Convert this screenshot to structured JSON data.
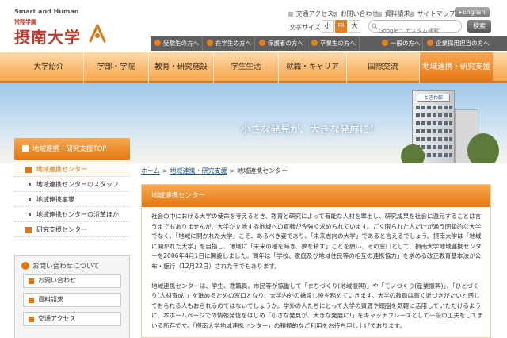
{
  "header": {
    "logo_tagline": "Smart and Human",
    "logo_subtitle": "常翔学園",
    "logo_name": "摂南大学",
    "utility_links": [
      "交通アクセス",
      "お問い合わせ",
      "資料請求",
      "サイトマップ"
    ],
    "english_label": "English",
    "font_size_label": "文字サイズ",
    "font_sizes": [
      "小",
      "中",
      "大"
    ],
    "search_placeholder": "Google™ カスタム検索",
    "search_button": "検索"
  },
  "audience_nav": [
    "受験生の方へ",
    "在学生の方へ",
    "保護者の方へ",
    "卒業生の方へ",
    "一般の方へ",
    "企業採用担当の方へ"
  ],
  "global_nav": {
    "items": [
      "大学紹介",
      "学部・学院",
      "教育・研究施設",
      "学生生活",
      "就職・キャリア",
      "国際交流",
      "地域連携・研究支援"
    ],
    "active_index": 6
  },
  "hero": {
    "tagline": "小さな発見が、大きな発展に！",
    "building_sign": "ときわ館"
  },
  "sidebar": {
    "heading": "地域連携・研究支援TOP",
    "items": [
      {
        "label": "地域連携センター",
        "kind": "current"
      },
      {
        "label": "地域連携センターのスタッフ",
        "kind": "sub"
      },
      {
        "label": "地域連携事業",
        "kind": "sub"
      },
      {
        "label": "地域連携センターの沿革ほか",
        "kind": "sub"
      },
      {
        "label": "研究支援センター",
        "kind": "main"
      }
    ],
    "contact": {
      "heading": "お問い合わせについて",
      "buttons": [
        "お問い合わせ",
        "資料請求",
        "交通アクセス"
      ]
    }
  },
  "breadcrumb": [
    "ホーム",
    "地域連携・研究支援",
    "地域連携センター"
  ],
  "content": {
    "title": "地域連携センター",
    "paragraphs": [
      "社会の中における大学の使命を考えるとき、教育と研究によって有能な人材を輩出し、研究成果を社会に還元することは言うまでもありませんが、大学が立地する地域への貢献が今強く求められています。ごく限られた人だけが通う閉鎖的な大学でなく、「地域に開かれた大学」こそ、あるべき姿であり、「未来志向の大学」であると言えるでしょう。摂南大学は「地域に開かれた大学」を目指し、地域に「未来の種を蒔き、夢を耕す」ことを願い、その窓口として、摂南大学地域連携センターを2006年4月1日に開設しました。同年は「学校、家庭及び地域住民等の相互の連携協力」を求める改正教育基本法が公布・施行（12月22日）された年でもあります。",
      "地域連携センターは、学生、教職員、市民等が協働して「まちづくり(地域振興)」や「モノづくり(産業振興)」、「ひとづくり(人材育成)」を進めるための窓口となり、大学内外の橋渡し役を務めていきます。大学の教員は高く近づきがたいと感じておられる人もおられるのではないでしょうか。学外の人たちにとって大学の資源や頭脳を気軽に活用していただけるように、本ホームページでの情報発信をはじめ「小さな発見が、大きな発展に!」をキャッチフレーズとして一段の工夫をしてまいる所存です。「摂南大学地域連携センター」の積極的なご利用をお待ち申し上げております。"
    ]
  },
  "colors": {
    "accent": "#e47612",
    "nav_light": "#ffd9a8",
    "audience_bar": "#5f5f5f",
    "brand_red": "#c0392b",
    "link": "#1a4f8a"
  }
}
